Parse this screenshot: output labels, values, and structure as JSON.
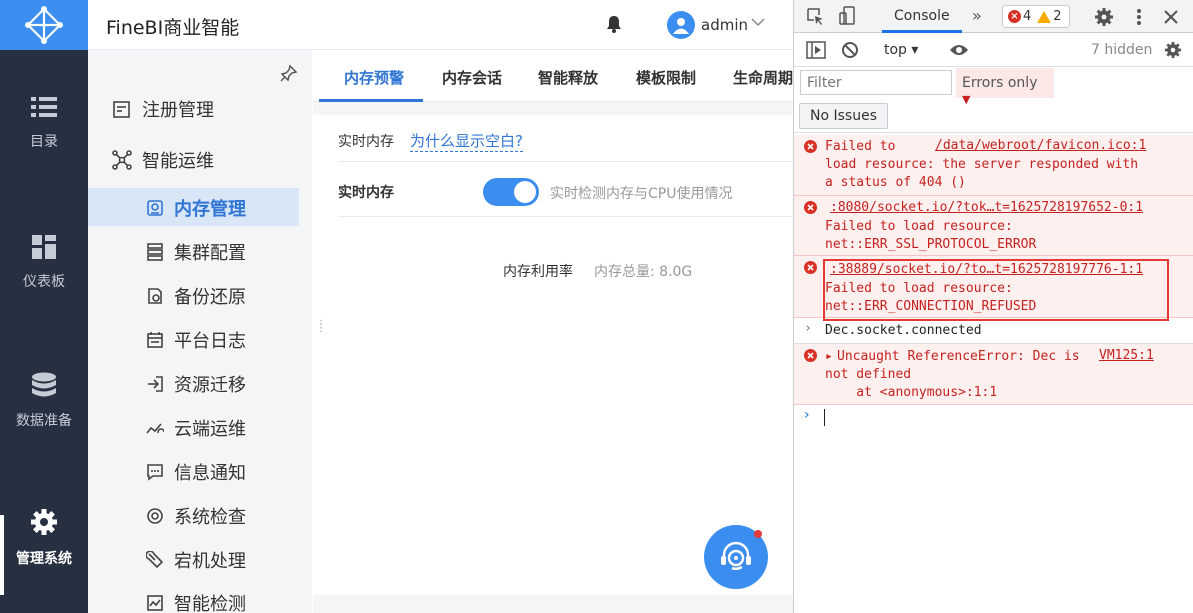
{
  "app": {
    "title": "FineBI商业智能"
  },
  "header": {
    "user": "admin"
  },
  "leftnav": [
    {
      "label": "目录",
      "icon": "list-icon"
    },
    {
      "label": "仪表板",
      "icon": "dashboard-icon"
    },
    {
      "label": "数据准备",
      "icon": "database-icon"
    },
    {
      "label": "管理系统",
      "icon": "gear-icon"
    }
  ],
  "submenu": {
    "items": [
      {
        "label": "注册管理"
      },
      {
        "label": "智能运维"
      },
      {
        "label": "内存管理"
      },
      {
        "label": "集群配置"
      },
      {
        "label": "备份还原"
      },
      {
        "label": "平台日志"
      },
      {
        "label": "资源迁移"
      },
      {
        "label": "云端运维"
      },
      {
        "label": "信息通知"
      },
      {
        "label": "系统检查"
      },
      {
        "label": "宕机处理"
      },
      {
        "label": "智能检测"
      }
    ]
  },
  "tabs": [
    "内存预警",
    "内存会话",
    "智能释放",
    "模板限制",
    "生命周期"
  ],
  "panel": {
    "heading": "实时内存",
    "why_link": "为什么显示空白?",
    "toggle_label": "实时内存",
    "toggle_on": true,
    "toggle_desc": "实时检测内存与CPU使用情况",
    "mem_usage": "内存利用率",
    "mem_total": "内存总量: 8.0G"
  },
  "devtools": {
    "tab": "Console",
    "more": "»",
    "error_count": "4",
    "warning_count": "2",
    "context": "top",
    "hidden": "7 hidden",
    "filter_placeholder": "Filter",
    "level": "Errors only",
    "issues_button": "No Issues",
    "messages": [
      {
        "src": "/data/webroot/favicon.ico:1",
        "line1": "Failed to ",
        "line2": "load resource: the server responded with",
        "line3": "a status of 404 ()"
      },
      {
        "src": ":8080/socket.io/?tok…t=1625728197652-0:1",
        "line1": "Failed to load resource:",
        "line2": "net::ERR_SSL_PROTOCOL_ERROR"
      },
      {
        "src": ":38889/socket.io/?to…t=1625728197776-1:1",
        "line1": "Failed to load resource:",
        "line2": "net::ERR_CONNECTION_REFUSED"
      }
    ],
    "info": "Dec.socket.connected",
    "uncaught": {
      "text": "Uncaught ReferenceError: Dec is",
      "src": "VM125:1",
      "line2": "not defined",
      "line3": "    at <anonymous>:1:1"
    }
  },
  "colors": {
    "accent": "#3c8df0",
    "sidebar": "#263040",
    "error": "#c5221f"
  }
}
